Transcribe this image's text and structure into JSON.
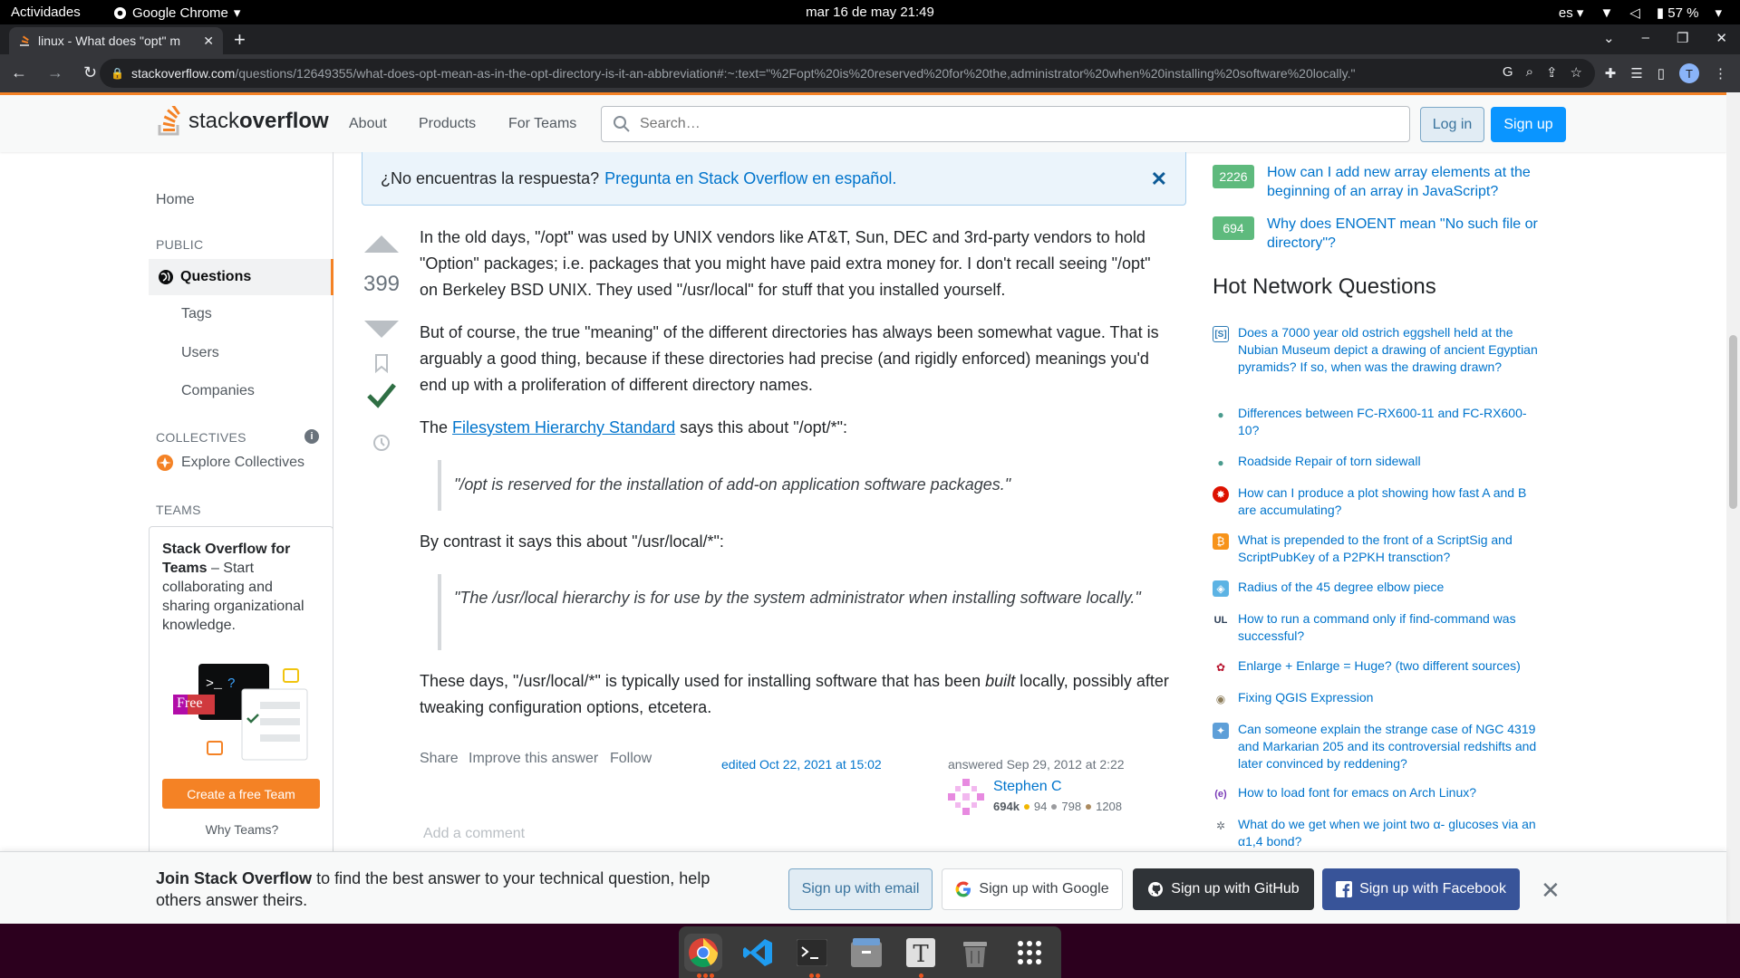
{
  "topbar": {
    "activities": "Actividades",
    "app_name": "Google Chrome",
    "clock": "mar 16 de may  21:49",
    "lang": "es",
    "battery": "57 %"
  },
  "browser": {
    "tab_title": "linux - What does \"opt\" m",
    "url_domain": "stackoverflow.com",
    "url_path": "/questions/12649355/what-does-opt-mean-as-in-the-opt-directory-is-it-an-abbreviation#:~:text=\"%2Fopt%20is%20reserved%20for%20the,administrator%20when%20installing%20software%20locally.\"",
    "profile_initial": "T"
  },
  "header": {
    "logo_stack": "stack",
    "logo_overflow": "overflow",
    "nav": [
      "About",
      "Products",
      "For Teams"
    ],
    "search_placeholder": "Search…",
    "login": "Log in",
    "signup": "Sign up"
  },
  "sidebar": {
    "home": "Home",
    "public": "PUBLIC",
    "questions": "Questions",
    "tags": "Tags",
    "users": "Users",
    "companies": "Companies",
    "collectives": "COLLECTIVES",
    "explore_collectives": "Explore Collectives",
    "teams": "TEAMS",
    "teams_title": "Stack Overflow for Teams",
    "teams_desc": " – Start collaborating and sharing organizational knowledge.",
    "free_badge": "Free",
    "create_team": "Create a free Team",
    "why_teams": "Why Teams?"
  },
  "banner": {
    "text": "¿No encuentras la respuesta?",
    "link": "Pregunta en Stack Overflow en español."
  },
  "answer": {
    "votes": "399",
    "p1": "In the old days, \"/opt\" was used by UNIX vendors like AT&T, Sun, DEC and 3rd-party vendors to hold \"Option\" packages; i.e. packages that you might have paid extra money for. I don't recall seeing \"/opt\" on Berkeley BSD UNIX. They used \"/usr/local\" for stuff that you installed yourself.",
    "p2": "But of course, the true \"meaning\" of the different directories has always been somewhat vague. That is arguably a good thing, because if these directories had precise (and rigidly enforced) meanings you'd end up with a proliferation of different directory names.",
    "p3_pre": "The ",
    "p3_link": "Filesystem Hierarchy Standard",
    "p3_post": " says this about \"/opt/*\":",
    "quote1": "\"/opt is reserved for the installation of add-on application software packages.\"",
    "p4": "By contrast it says this about \"/usr/local/*\":",
    "quote2": "\"The /usr/local hierarchy is for use by the system administrator when installing software locally.\"",
    "p5_pre": "These days, \"/usr/local/*\" is typically used for installing software that has been ",
    "p5_em": "built",
    "p5_post": " locally, possibly after tweaking configuration options, etcetera.",
    "share": "Share",
    "improve": "Improve this answer",
    "follow": "Follow",
    "edited": "edited Oct 22, 2021 at 15:02",
    "answered": "answered Sep 29, 2012 at 2:22",
    "user_name": "Stephen C",
    "user_rep": "694k",
    "gold": "94",
    "silver": "798",
    "bronze": "1208",
    "add_comment": "Add a comment"
  },
  "related": [
    {
      "score": "2226",
      "title": "How can I add new array elements at the beginning of an array in JavaScript?"
    },
    {
      "score": "694",
      "title": "Why does ENOENT mean \"No such file or directory\"?"
    }
  ],
  "hnq": {
    "title": "Hot Network Questions",
    "items": [
      {
        "icon": "[S]",
        "title": "Does a 7000 year old ostrich eggshell held at the Nubian Museum depict a drawing of ancient Egyptian pyramids? If so, when was the drawing drawn?"
      },
      {
        "icon": "●",
        "title": "Differences between FC-RX600-11 and FC-RX600-10?"
      },
      {
        "icon": "●",
        "title": "Roadside Repair of torn sidewall"
      },
      {
        "icon": "✸",
        "title": "How can I produce a plot showing how fast A and B are accumulating?"
      },
      {
        "icon": "₿",
        "title": "What is prepended to the front of a ScriptSig and ScriptPubKey of a P2PKH transction?"
      },
      {
        "icon": "◈",
        "title": "Radius of the 45 degree elbow piece"
      },
      {
        "icon": "UL",
        "title": "How to run a command only if find-command was successful?"
      },
      {
        "icon": "✿",
        "title": "Enlarge + Enlarge = Huge? (two different sources)"
      },
      {
        "icon": "◉",
        "title": "Fixing QGIS Expression"
      },
      {
        "icon": "✦",
        "title": "Can someone explain the strange case of NGC 4319 and Markarian 205 and its controversial redshifts and later convinced by reddening?"
      },
      {
        "icon": "(e)",
        "title": "How to load font for emacs on Arch Linux?"
      },
      {
        "icon": "✲",
        "title": "What do we get when we joint two α- glucoses via an α1,4 bond?"
      }
    ]
  },
  "joinbar": {
    "bold": "Join Stack Overflow",
    "text": " to find the best answer to your technical question, help others answer theirs.",
    "email": "Sign up with email",
    "google": "Sign up with Google",
    "github": "Sign up with GitHub",
    "facebook": "Sign up with Facebook"
  },
  "colors": {
    "accent": "#f48225",
    "link": "#0074cc",
    "accepted": "#2f6f44"
  }
}
